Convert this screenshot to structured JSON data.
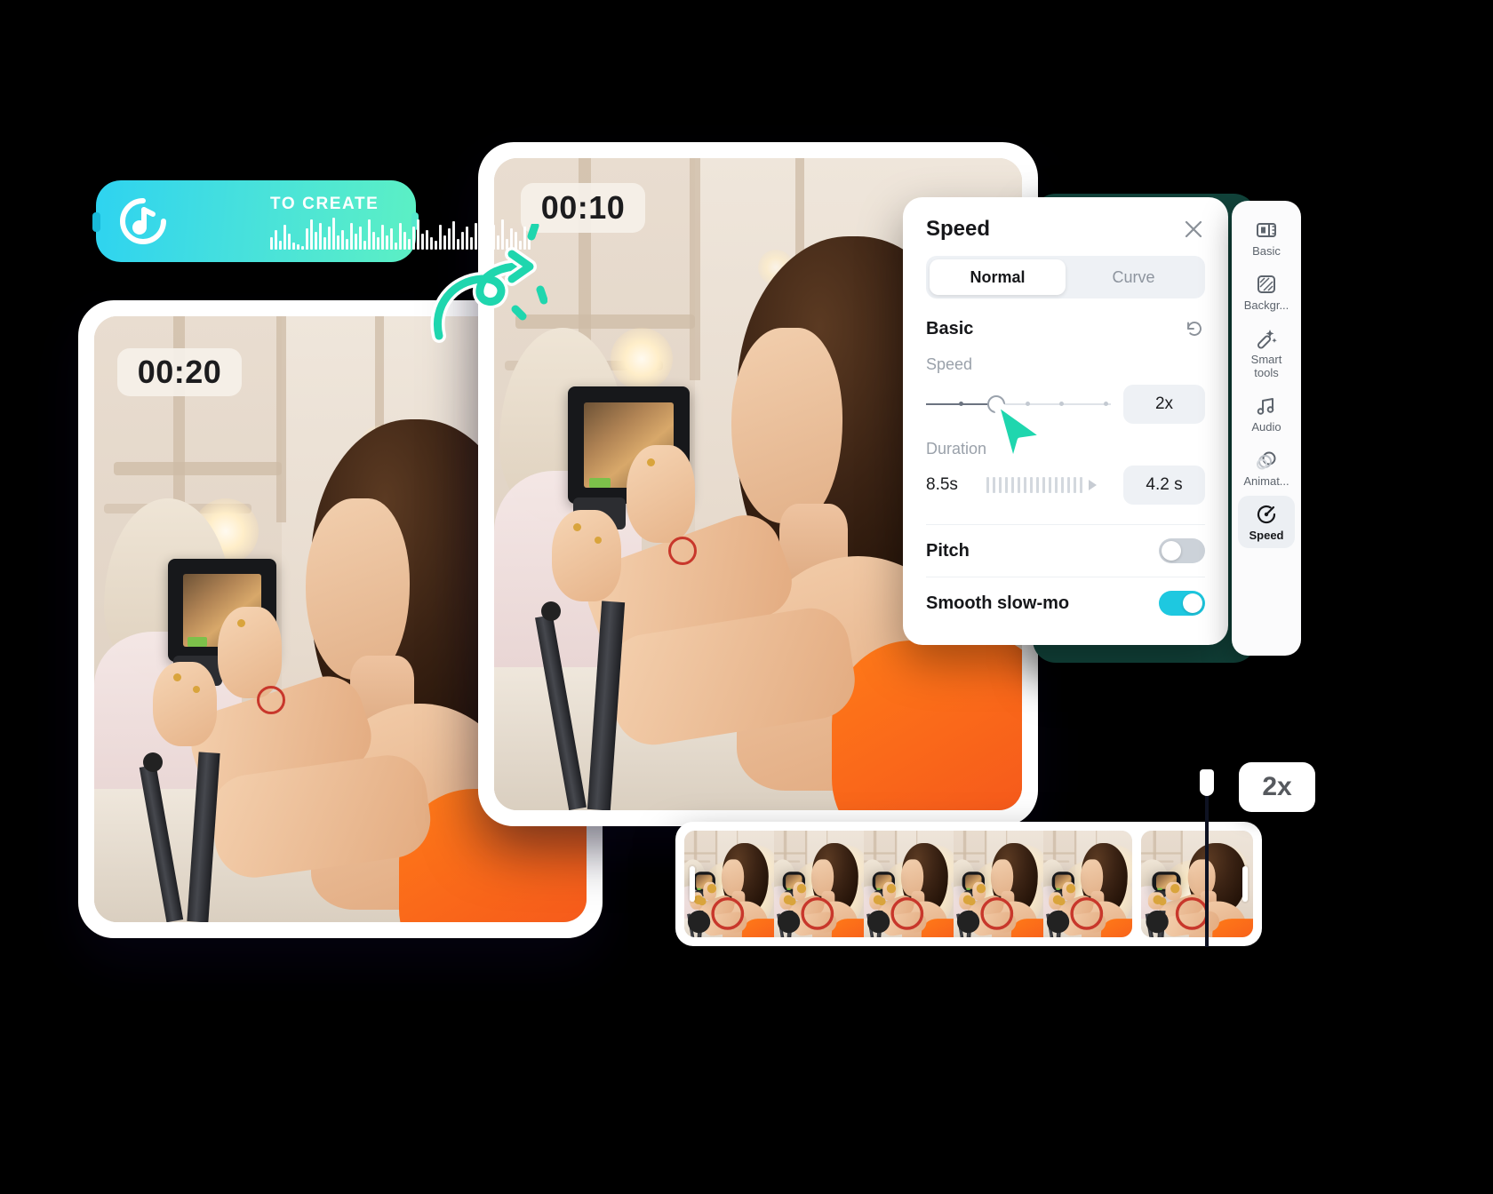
{
  "audio_chip": {
    "label": "TO CREATE",
    "icon": "music-disc-icon",
    "gradient_from": "#2ed3f0",
    "gradient_to": "#5cf0c4"
  },
  "previews": [
    {
      "name": "preview-back",
      "timestamp": "00:20"
    },
    {
      "name": "preview-front",
      "timestamp": "00:10"
    }
  ],
  "speed_panel": {
    "title": "Speed",
    "close_icon": "close-icon",
    "tabs": [
      {
        "label": "Normal",
        "active": true
      },
      {
        "label": "Curve",
        "active": false
      }
    ],
    "section": {
      "title": "Basic",
      "reset_icon": "reset-icon"
    },
    "speed": {
      "label": "Speed",
      "value": "2x",
      "slider_percent": 36,
      "tick_count": 5
    },
    "duration": {
      "label": "Duration",
      "from": "8.5s",
      "to": "4.2 s",
      "arrow_icon": "play-arrow-icon"
    },
    "toggles": [
      {
        "label": "Pitch",
        "on": false
      },
      {
        "label": "Smooth slow-mo",
        "on": true
      }
    ],
    "accent_on": "#1ec8e0",
    "accent_off": "#ccd2d9"
  },
  "sidebar": {
    "background": "#12453c",
    "items": [
      {
        "label": "Basic",
        "icon": "filmstrip-icon",
        "active": false
      },
      {
        "label": "Backgr...",
        "icon": "background-icon",
        "active": false
      },
      {
        "label": "Smart\ntools",
        "icon": "magic-wand-icon",
        "active": false
      },
      {
        "label": "Audio",
        "icon": "music-note-icon",
        "active": false
      },
      {
        "label": "Animat...",
        "icon": "animation-icon",
        "active": false
      },
      {
        "label": "Speed",
        "icon": "speedometer-icon",
        "active": true
      }
    ]
  },
  "timeline": {
    "speed_badge": "2x",
    "playhead_name": "playhead",
    "clips": [
      {
        "name": "clip-primary",
        "frame_count": 5
      },
      {
        "name": "clip-secondary",
        "frame_count": 1
      }
    ]
  },
  "cursor": {
    "icon": "mouse-pointer-icon",
    "color": "#1fd6ae"
  }
}
